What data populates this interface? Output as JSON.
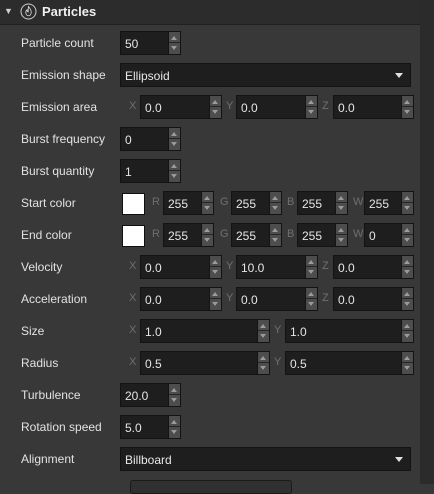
{
  "section": {
    "title": "Particles",
    "icon": "fire-icon",
    "expanded": true
  },
  "particle_count": {
    "label": "Particle count",
    "value": "50"
  },
  "emission_shape": {
    "label": "Emission shape",
    "value": "Ellipsoid"
  },
  "emission_area": {
    "label": "Emission area",
    "x_label": "X",
    "y_label": "Y",
    "z_label": "Z",
    "x": "0.0",
    "y": "0.0",
    "z": "0.0"
  },
  "burst_frequency": {
    "label": "Burst frequency",
    "value": "0"
  },
  "burst_quantity": {
    "label": "Burst quantity",
    "value": "1"
  },
  "start_color": {
    "label": "Start color",
    "swatch": "#ffffff",
    "r_label": "R",
    "g_label": "G",
    "b_label": "B",
    "w_label": "W",
    "r": "255",
    "g": "255",
    "b": "255",
    "w": "255"
  },
  "end_color": {
    "label": "End color",
    "swatch": "#ffffff",
    "r_label": "R",
    "g_label": "G",
    "b_label": "B",
    "w_label": "W",
    "r": "255",
    "g": "255",
    "b": "255",
    "w": "0"
  },
  "velocity": {
    "label": "Velocity",
    "x_label": "X",
    "y_label": "Y",
    "z_label": "Z",
    "x": "0.0",
    "y": "10.0",
    "z": "0.0"
  },
  "acceleration": {
    "label": "Acceleration",
    "x_label": "X",
    "y_label": "Y",
    "z_label": "Z",
    "x": "0.0",
    "y": "0.0",
    "z": "0.0"
  },
  "size": {
    "label": "Size",
    "x_label": "X",
    "y_label": "Y",
    "x": "1.0",
    "y": "1.0"
  },
  "radius": {
    "label": "Radius",
    "x_label": "X",
    "y_label": "Y",
    "x": "0.5",
    "y": "0.5"
  },
  "turbulence": {
    "label": "Turbulence",
    "value": "20.0"
  },
  "rotation_speed": {
    "label": "Rotation speed",
    "value": "5.0"
  },
  "alignment": {
    "label": "Alignment",
    "value": "Billboard"
  }
}
